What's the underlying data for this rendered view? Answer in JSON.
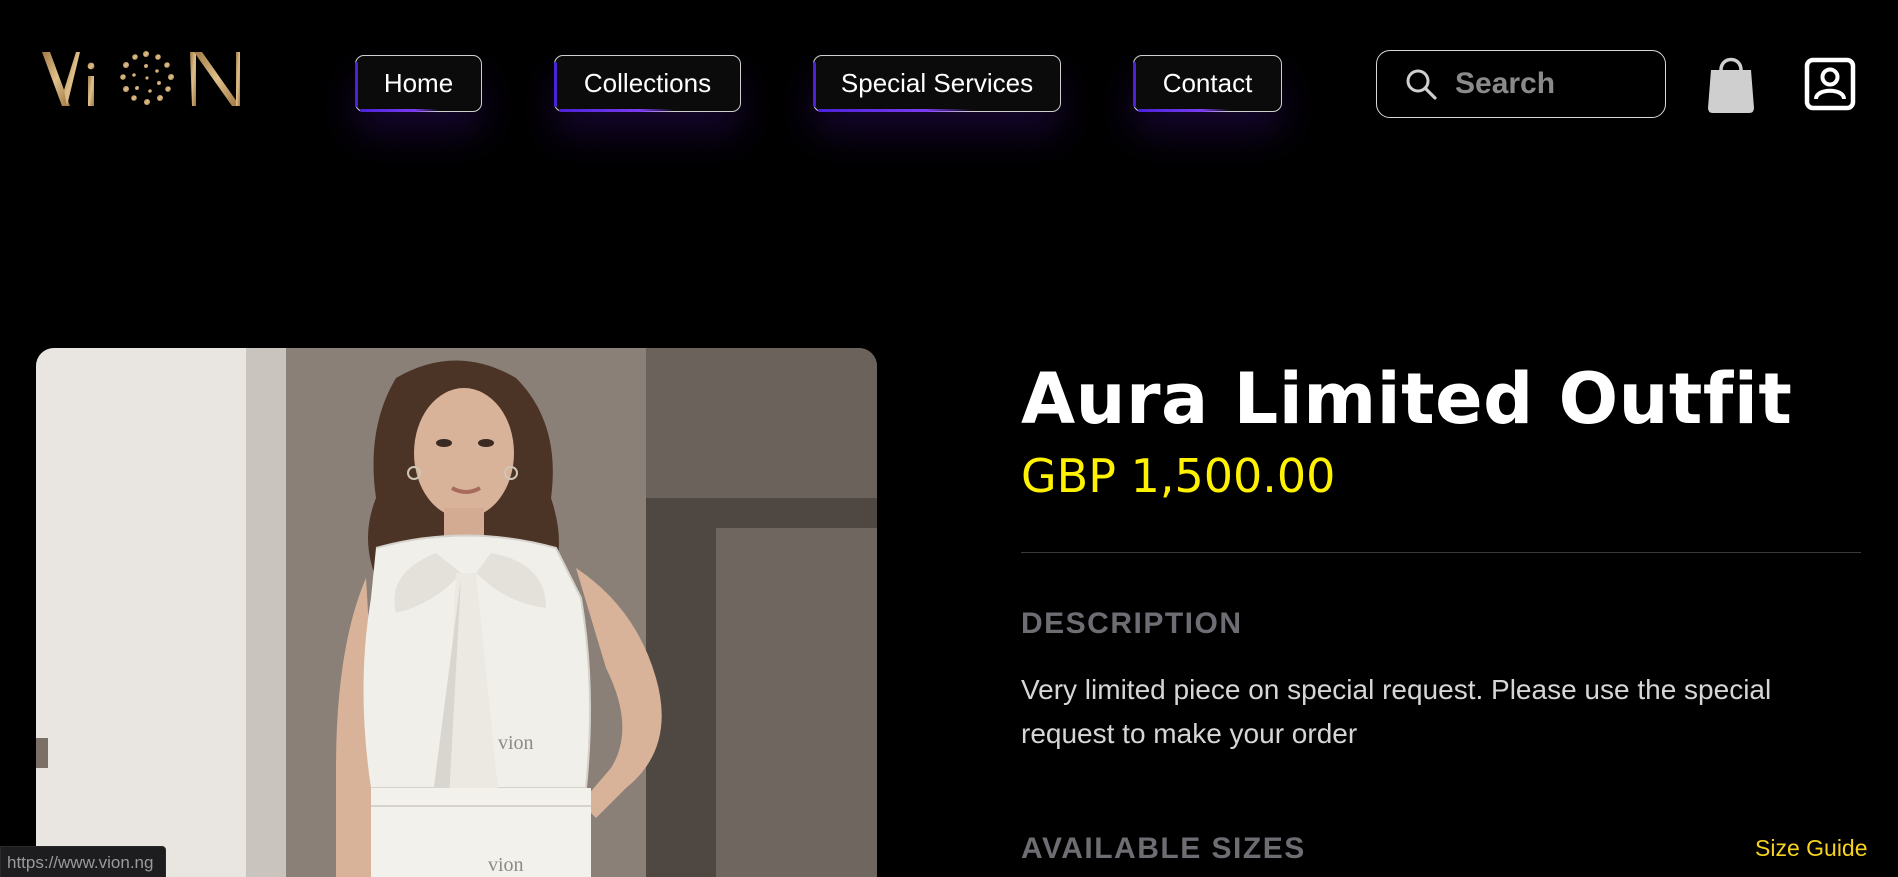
{
  "brand": {
    "logo_text": "ViON"
  },
  "nav": {
    "items": [
      {
        "label": "Home"
      },
      {
        "label": "Collections"
      },
      {
        "label": "Special Services"
      },
      {
        "label": "Contact"
      }
    ]
  },
  "search": {
    "placeholder": "Search"
  },
  "icons": {
    "search": "search-icon",
    "cart": "shopping-bag-icon",
    "account": "user-account-icon"
  },
  "product": {
    "title": "Aura Limited Outfit",
    "price": "GBP 1,500.00",
    "description_label": "DESCRIPTION",
    "description": "Very limited piece on special request. Please use the special request to make your order",
    "sizes_label": "AVAILABLE SIZES",
    "size_guide": "Size Guide",
    "image_alt": "Model wearing white satin sleeveless blouse with bow",
    "image_watermark_1": "vion",
    "image_watermark_2": "vion"
  },
  "status_bar": {
    "url": "https://www.vion.ng"
  },
  "colors": {
    "background": "#000000",
    "price": "#fff200",
    "accent": "#4b22d8",
    "size_guide": "#f5d21f",
    "logo_gold": "#c9a46a"
  }
}
